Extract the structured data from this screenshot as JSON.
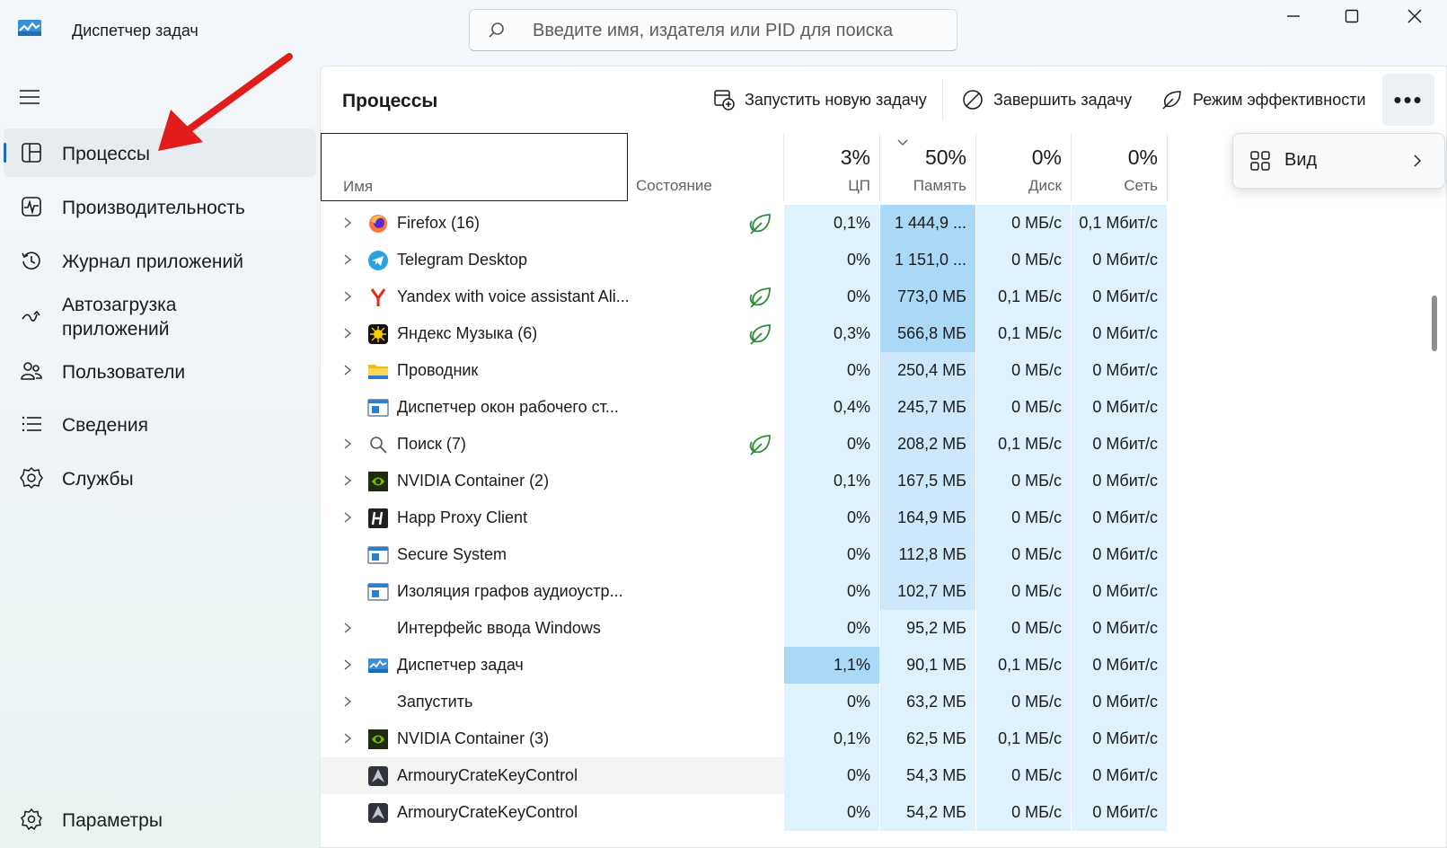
{
  "app": {
    "title": "Диспетчер задач",
    "search_placeholder": "Введите имя, издателя или PID для поиска"
  },
  "sidebar": {
    "items": [
      {
        "label": "Процессы",
        "icon": "processes-icon",
        "active": true
      },
      {
        "label": "Производительность",
        "icon": "performance-icon"
      },
      {
        "label": "Журнал приложений",
        "icon": "app-history-icon"
      },
      {
        "label": "Автозагрузка\nприложений",
        "icon": "startup-apps-icon"
      },
      {
        "label": "Пользователи",
        "icon": "users-icon"
      },
      {
        "label": "Сведения",
        "icon": "details-icon"
      },
      {
        "label": "Службы",
        "icon": "services-icon"
      }
    ],
    "settings_label": "Параметры"
  },
  "toolbar": {
    "title": "Процессы",
    "run_task": "Запустить новую задачу",
    "end_task": "Завершить задачу",
    "efficiency_mode": "Режим эффективности",
    "more": "•••"
  },
  "view_menu": {
    "label": "Вид"
  },
  "columns": {
    "name": "Имя",
    "state": "Состояние",
    "cpu": {
      "pct": "3%",
      "label": "ЦП"
    },
    "memory": {
      "pct": "50%",
      "label": "Память"
    },
    "disk": {
      "pct": "0%",
      "label": "Диск"
    },
    "network": {
      "pct": "0%",
      "label": "Сеть"
    }
  },
  "processes": [
    {
      "name": "Firefox (16)",
      "icon": "firefox-icon",
      "expand": true,
      "eco": true,
      "cpu": "0,1%",
      "mem": "1 444,9 ...",
      "disk": "0 МБ/с",
      "net": "0,1 Мбит/с",
      "mem_level": "hi"
    },
    {
      "name": "Telegram Desktop",
      "icon": "telegram-icon",
      "expand": true,
      "eco": false,
      "cpu": "0%",
      "mem": "1 151,0 ...",
      "disk": "0 МБ/с",
      "net": "0 Мбит/с",
      "mem_level": "hi"
    },
    {
      "name": "Yandex with voice assistant Ali...",
      "icon": "yandex-browser-icon",
      "expand": true,
      "eco": true,
      "cpu": "0%",
      "mem": "773,0 МБ",
      "disk": "0,1 МБ/с",
      "net": "0 Мбит/с",
      "mem_level": "hi"
    },
    {
      "name": "Яндекс Музыка (6)",
      "icon": "yandex-music-icon",
      "expand": true,
      "eco": true,
      "cpu": "0,3%",
      "mem": "566,8 МБ",
      "disk": "0,1 МБ/с",
      "net": "0 Мбит/с",
      "mem_level": "hi"
    },
    {
      "name": "Проводник",
      "icon": "explorer-folder-icon",
      "expand": true,
      "eco": false,
      "cpu": "0%",
      "mem": "250,4 МБ",
      "disk": "0 МБ/с",
      "net": "0 Мбит/с",
      "mem_level": "med"
    },
    {
      "name": "Диспетчер окон рабочего ст...",
      "icon": "system-window-icon",
      "expand": false,
      "eco": false,
      "cpu": "0,4%",
      "mem": "245,7 МБ",
      "disk": "0 МБ/с",
      "net": "0 Мбит/с",
      "mem_level": "med"
    },
    {
      "name": "Поиск (7)",
      "icon": "search-process-icon",
      "expand": true,
      "eco": true,
      "cpu": "0%",
      "mem": "208,2 МБ",
      "disk": "0,1 МБ/с",
      "net": "0 Мбит/с",
      "mem_level": "med"
    },
    {
      "name": "NVIDIA Container (2)",
      "icon": "nvidia-icon",
      "expand": true,
      "eco": false,
      "cpu": "0,1%",
      "mem": "167,5 МБ",
      "disk": "0 МБ/с",
      "net": "0 Мбит/с",
      "mem_level": "med"
    },
    {
      "name": "Happ Proxy Client",
      "icon": "happ-icon",
      "expand": true,
      "eco": false,
      "cpu": "0%",
      "mem": "164,9 МБ",
      "disk": "0 МБ/с",
      "net": "0 Мбит/с",
      "mem_level": "med"
    },
    {
      "name": "Secure System",
      "icon": "system-window-icon",
      "expand": false,
      "eco": false,
      "cpu": "0%",
      "mem": "112,8 МБ",
      "disk": "0 МБ/с",
      "net": "0 Мбит/с",
      "mem_level": "med"
    },
    {
      "name": "Изоляция графов аудиоустр...",
      "icon": "system-window-icon",
      "expand": false,
      "eco": false,
      "cpu": "0%",
      "mem": "102,7 МБ",
      "disk": "0 МБ/с",
      "net": "0 Мбит/с",
      "mem_level": "med"
    },
    {
      "name": "Интерфейс ввода Windows",
      "icon": "",
      "expand": true,
      "eco": false,
      "cpu": "0%",
      "mem": "95,2 МБ",
      "disk": "0 МБ/с",
      "net": "0 Мбит/с",
      "mem_level": "low"
    },
    {
      "name": "Диспетчер задач",
      "icon": "task-manager-icon",
      "expand": true,
      "eco": false,
      "cpu": "1,1%",
      "mem": "90,1 МБ",
      "disk": "0,1 МБ/с",
      "net": "0 Мбит/с",
      "mem_level": "low",
      "cpu_level": "hi"
    },
    {
      "name": "Запустить",
      "icon": "",
      "expand": true,
      "eco": false,
      "cpu": "0%",
      "mem": "63,2 МБ",
      "disk": "0 МБ/с",
      "net": "0 Мбит/с",
      "mem_level": "low"
    },
    {
      "name": "NVIDIA Container (3)",
      "icon": "nvidia-icon",
      "expand": true,
      "eco": false,
      "cpu": "0,1%",
      "mem": "62,5 МБ",
      "disk": "0,1 МБ/с",
      "net": "0 Мбит/с",
      "mem_level": "low"
    },
    {
      "name": "ArmouryCrateKeyControl",
      "icon": "armoury-crate-icon",
      "expand": false,
      "eco": false,
      "cpu": "0%",
      "mem": "54,3 МБ",
      "disk": "0 МБ/с",
      "net": "0 Мбит/с",
      "mem_level": "low",
      "hover": true
    },
    {
      "name": "ArmouryCrateKeyControl",
      "icon": "armoury-crate-icon",
      "expand": false,
      "eco": false,
      "cpu": "0%",
      "mem": "54,2 МБ",
      "disk": "0 МБ/с",
      "net": "0 Мбит/с",
      "mem_level": "low"
    }
  ]
}
